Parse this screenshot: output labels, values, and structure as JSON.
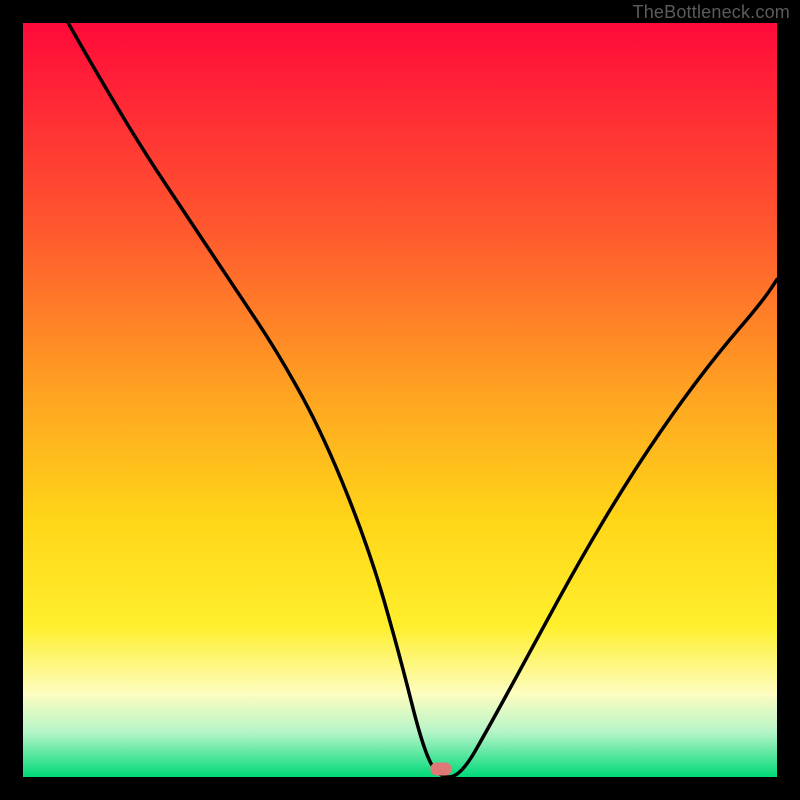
{
  "watermark": "TheBottleneck.com",
  "colors": {
    "top": "#ff0a3a",
    "mid1": "#ff5a2e",
    "mid2": "#ffa621",
    "mid3": "#ffd618",
    "mid4": "#ffef2d",
    "pale": "#fdfdc0",
    "mint": "#b6f5c8",
    "green": "#00d978",
    "marker": "#e07878",
    "curve": "#000000"
  },
  "marker": {
    "x_pct": 55.4,
    "y_pct": 99.0
  },
  "chart_data": {
    "type": "line",
    "title": "",
    "xlabel": "",
    "ylabel": "",
    "xlim": [
      0,
      100
    ],
    "ylim": [
      0,
      100
    ],
    "series": [
      {
        "name": "bottleneck-curve",
        "x": [
          6,
          10,
          16,
          22,
          28,
          34,
          40,
          46,
          50,
          53,
          55,
          58,
          62,
          68,
          74,
          80,
          86,
          92,
          98,
          100
        ],
        "values": [
          100,
          93,
          83,
          74,
          65,
          56,
          45,
          30,
          16,
          4,
          0,
          0,
          7,
          18,
          29,
          39,
          48,
          56,
          63,
          66
        ]
      }
    ],
    "gradient_stops": [
      {
        "pct": 0,
        "color": "#ff0a3a"
      },
      {
        "pct": 28,
        "color": "#ff5a2e"
      },
      {
        "pct": 50,
        "color": "#ffa621"
      },
      {
        "pct": 66,
        "color": "#ffd618"
      },
      {
        "pct": 80,
        "color": "#ffef2d"
      },
      {
        "pct": 89,
        "color": "#fdfdc0"
      },
      {
        "pct": 94,
        "color": "#b6f5c8"
      },
      {
        "pct": 100,
        "color": "#00d978"
      }
    ],
    "annotations": [
      {
        "type": "marker",
        "x": 55.4,
        "y": 0,
        "label": ""
      }
    ]
  }
}
